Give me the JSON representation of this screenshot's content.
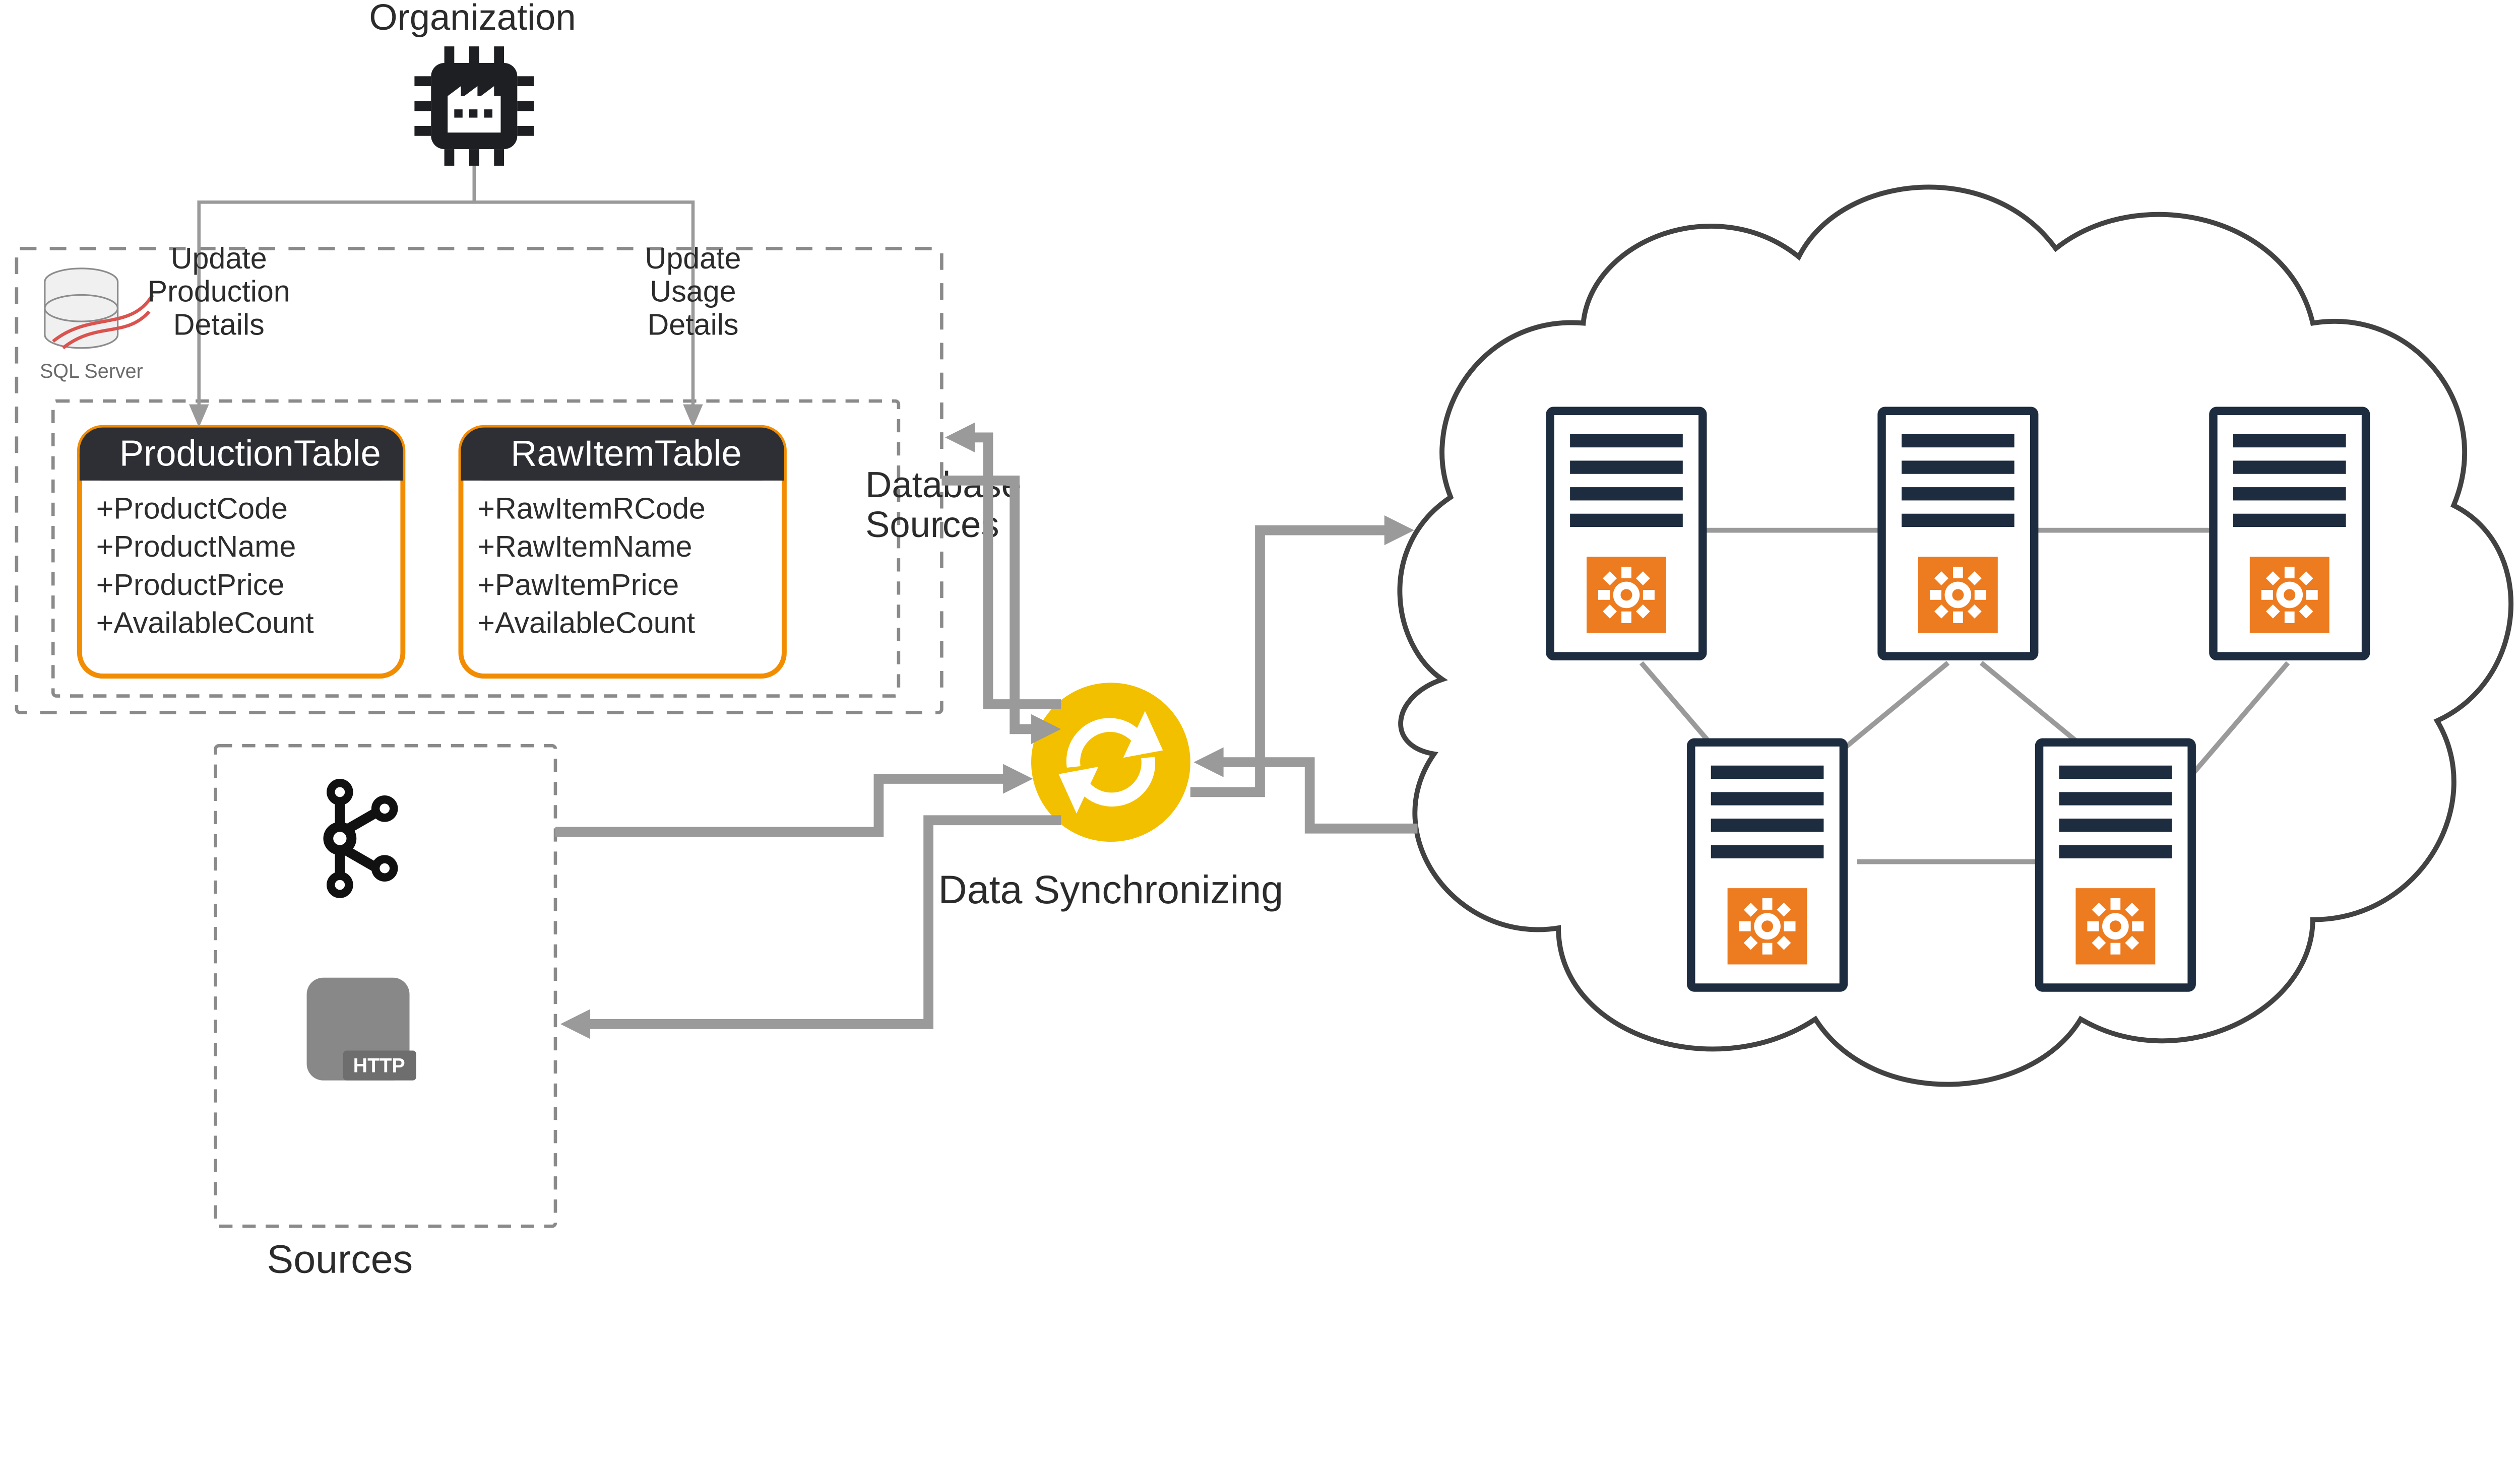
{
  "organization": {
    "label": "Organization"
  },
  "edges": {
    "update_production": {
      "l1": "Update",
      "l2": "Production",
      "l3": "Details"
    },
    "update_usage": {
      "l1": "Update",
      "l2": "Usage",
      "l3": "Details"
    }
  },
  "db_sources": {
    "group_label_l1": "Database",
    "group_label_l2": "Sources",
    "sql_server_label": "SQL Server",
    "tables": {
      "production": {
        "title": "ProductionTable",
        "fields": [
          "+ProductCode",
          "+ProductName",
          "+ProductPrice",
          "+AvailableCount"
        ]
      },
      "rawitem": {
        "title": "RawItemTable",
        "fields": [
          "+RawItemRCode",
          "+RawItemName",
          "+PawItemPrice",
          "+AvailableCount"
        ]
      }
    }
  },
  "other_sources": {
    "group_label": "Sources",
    "http_badge": "HTTP"
  },
  "sync": {
    "label": "Data Synchronizing"
  },
  "colors": {
    "accent_orange": "#ed7b1f",
    "table_orange": "#f28c00",
    "dark_slate": "#1d2c3f",
    "sync_yellow": "#f3c000",
    "connector_gray": "#9a9a9a"
  }
}
